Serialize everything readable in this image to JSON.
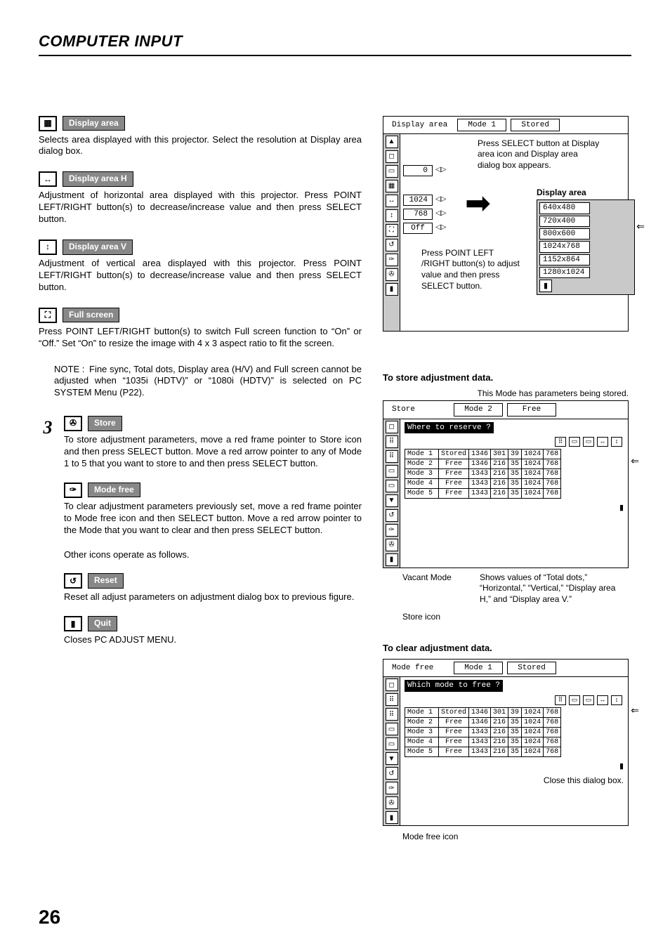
{
  "page": {
    "title": "COMPUTER INPUT",
    "number": "26"
  },
  "left": {
    "display_area": {
      "label": "Display area",
      "desc": "Selects area displayed with this projector.  Select the resolution at Display area dialog box."
    },
    "display_area_h": {
      "label": "Display area H",
      "desc": "Adjustment of horizontal area displayed with this projector.  Press POINT LEFT/RIGHT button(s) to decrease/increase value and then press SELECT button."
    },
    "display_area_v": {
      "label": "Display area V",
      "desc": "Adjustment of vertical area displayed with this projector.  Press POINT LEFT/RIGHT button(s) to decrease/increase value and then press SELECT button."
    },
    "full_screen": {
      "label": "Full screen",
      "desc": "Press POINT LEFT/RIGHT button(s) to switch Full screen function to “On” or “Off.”  Set “On” to resize the image with 4 x 3 aspect ratio to fit the screen."
    },
    "note": {
      "label": "NOTE :",
      "text": "Fine sync, Total dots, Display area (H/V) and Full screen cannot be adjusted when “1035i (HDTV)” or “1080i (HDTV)” is selected on PC SYSTEM Menu (P22)."
    },
    "step3": "3",
    "store": {
      "label": "Store",
      "desc": "To store adjustment parameters, move a red frame pointer to Store icon and then press SELECT button.  Move a red arrow pointer to any of Mode 1 to 5 that you want to store to and then press SELECT button."
    },
    "mode_free": {
      "label": "Mode free",
      "desc": "To clear adjustment parameters previously set, move a red frame pointer to Mode free icon and then SELECT button.  Move a red arrow pointer to the Mode that you want to clear and then press SELECT button."
    },
    "other": "Other icons operate as follows.",
    "reset": {
      "label": "Reset",
      "desc": "Reset all adjust parameters on adjustment dialog box to previous figure."
    },
    "quit": {
      "label": "Quit",
      "desc": "Closes PC ADJUST MENU."
    }
  },
  "right": {
    "panel1": {
      "title_name": "Display area",
      "title_mode": "Mode 1",
      "title_status": "Stored",
      "val_blank": "0",
      "val_h": "1024",
      "val_v": "768",
      "val_full": "Off",
      "callout_top": "Press SELECT button at Display area icon and Display area dialog box appears.",
      "callout_bottom": "Press POINT LEFT /RIGHT button(s) to adjust value and then press SELECT button.",
      "res_title": "Display area",
      "resolutions": [
        "640x480",
        "720x400",
        "800x600",
        "1024x768",
        "1152x864",
        "1280x1024"
      ]
    },
    "store": {
      "heading": "To store adjustment data.",
      "annot_top": "This Mode has parameters being stored.",
      "title_name": "Store",
      "title_mode": "Mode 2",
      "title_status": "Free",
      "dark_bar": "Where to reserve ?",
      "rows": [
        {
          "name": "Mode 1",
          "status": "Stored",
          "c1": "1346",
          "c2": "301",
          "c3": "39",
          "c4": "1024",
          "c5": "768"
        },
        {
          "name": "Mode 2",
          "status": "Free",
          "c1": "1346",
          "c2": "216",
          "c3": "35",
          "c4": "1024",
          "c5": "768"
        },
        {
          "name": "Mode 3",
          "status": "Free",
          "c1": "1343",
          "c2": "216",
          "c3": "35",
          "c4": "1024",
          "c5": "768"
        },
        {
          "name": "Mode 4",
          "status": "Free",
          "c1": "1343",
          "c2": "216",
          "c3": "35",
          "c4": "1024",
          "c5": "768"
        },
        {
          "name": "Mode 5",
          "status": "Free",
          "c1": "1343",
          "c2": "216",
          "c3": "35",
          "c4": "1024",
          "c5": "768"
        }
      ],
      "annot_vacant": "Vacant Mode",
      "annot_values": "Shows values of “Total dots,” “Horizontal,” “Vertical,” “Display area H,” and “Display area V.”",
      "annot_icon": "Store icon"
    },
    "clear": {
      "heading": "To clear adjustment data.",
      "title_name": "Mode free",
      "title_mode": "Mode 1",
      "title_status": "Stored",
      "dark_bar": "Which mode to free ?",
      "rows": [
        {
          "name": "Mode 1",
          "status": "Stored",
          "c1": "1346",
          "c2": "301",
          "c3": "39",
          "c4": "1024",
          "c5": "768"
        },
        {
          "name": "Mode 2",
          "status": "Free",
          "c1": "1346",
          "c2": "216",
          "c3": "35",
          "c4": "1024",
          "c5": "768"
        },
        {
          "name": "Mode 3",
          "status": "Free",
          "c1": "1343",
          "c2": "216",
          "c3": "35",
          "c4": "1024",
          "c5": "768"
        },
        {
          "name": "Mode 4",
          "status": "Free",
          "c1": "1343",
          "c2": "216",
          "c3": "35",
          "c4": "1024",
          "c5": "768"
        },
        {
          "name": "Mode 5",
          "status": "Free",
          "c1": "1343",
          "c2": "216",
          "c3": "35",
          "c4": "1024",
          "c5": "768"
        }
      ],
      "annot_close": "Close this dialog box.",
      "annot_icon": "Mode free icon"
    }
  }
}
